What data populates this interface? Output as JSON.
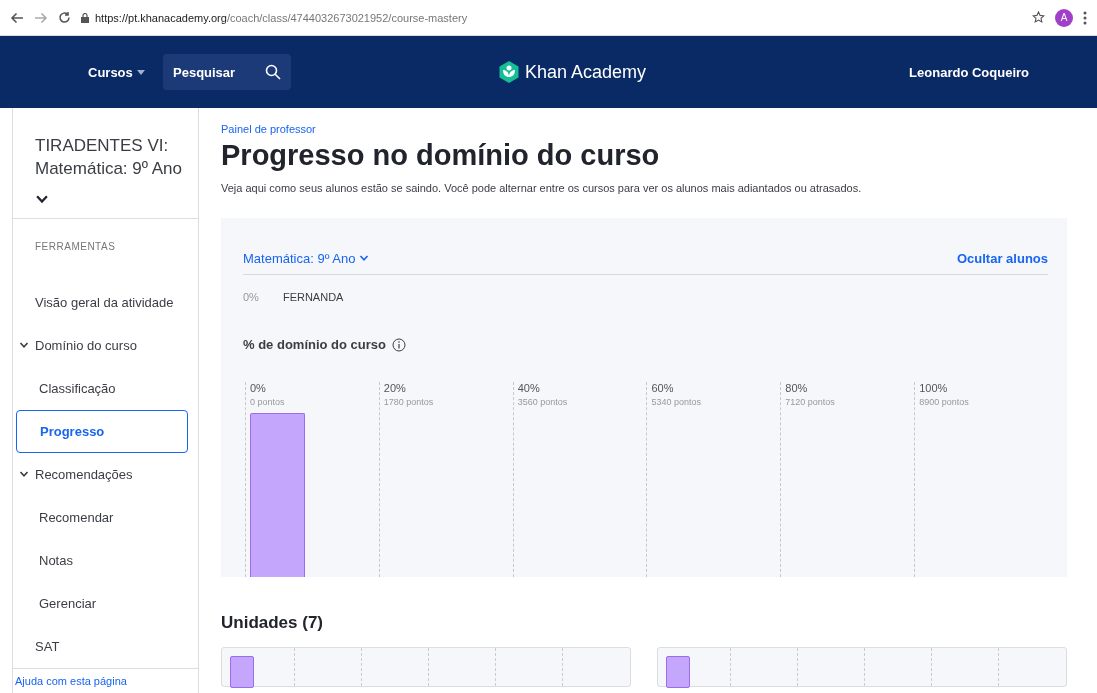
{
  "browser": {
    "url_host": "https://pt.khanacademy.org",
    "url_path": "/coach/class/4744032673021952/course-mastery",
    "avatar": "A"
  },
  "nav": {
    "courses": "Cursos",
    "search_placeholder": "Pesquisar",
    "logo": "Khan Academy",
    "user": "Leonardo Coqueiro"
  },
  "sidebar": {
    "class_title": "TIRADENTES VI: Matemática: 9º Ano",
    "section": "FERRAMENTAS",
    "items": [
      {
        "label": "Visão geral da atividade",
        "kind": "link",
        "selected": false
      },
      {
        "label": "Domínio do curso",
        "kind": "group",
        "expanded": true,
        "children": [
          {
            "label": "Classificação",
            "kind": "link",
            "selected": false
          },
          {
            "label": "Progresso",
            "kind": "link",
            "selected": true
          }
        ]
      },
      {
        "label": "Recomendações",
        "kind": "group",
        "expanded": true,
        "children": [
          {
            "label": "Recomendar",
            "kind": "link",
            "selected": false
          },
          {
            "label": "Notas",
            "kind": "link",
            "selected": false
          },
          {
            "label": "Gerenciar",
            "kind": "link",
            "selected": false
          }
        ]
      },
      {
        "label": "SAT",
        "kind": "top",
        "selected": false
      }
    ],
    "help": "Ajuda com esta página"
  },
  "page": {
    "breadcrumb": "Painel de professor",
    "title": "Progresso no domínio do curso",
    "description": "Veja aqui como seus alunos estão se saindo. Você pode alternar entre os cursos para ver os alunos mais adiantados ou atrasados."
  },
  "panel": {
    "course": "Matemática: 9º Ano",
    "hide_students": "Ocultar alunos",
    "students": [
      {
        "percent": "0%",
        "name": "FERNANDA"
      }
    ],
    "mastery_label": "% de domínio do curso",
    "columns": [
      {
        "percent": "0%",
        "points": "0 pontos",
        "has_students": true
      },
      {
        "percent": "20%",
        "points": "1780 pontos",
        "has_students": false
      },
      {
        "percent": "40%",
        "points": "3560 pontos",
        "has_students": false
      },
      {
        "percent": "60%",
        "points": "5340 pontos",
        "has_students": false
      },
      {
        "percent": "80%",
        "points": "7120 pontos",
        "has_students": false
      },
      {
        "percent": "100%",
        "points": "8900 pontos",
        "has_students": false
      }
    ]
  },
  "units": {
    "heading": "Unidades (7)",
    "cards": [
      {
        "bar": true
      },
      {
        "bar": true
      }
    ]
  }
}
